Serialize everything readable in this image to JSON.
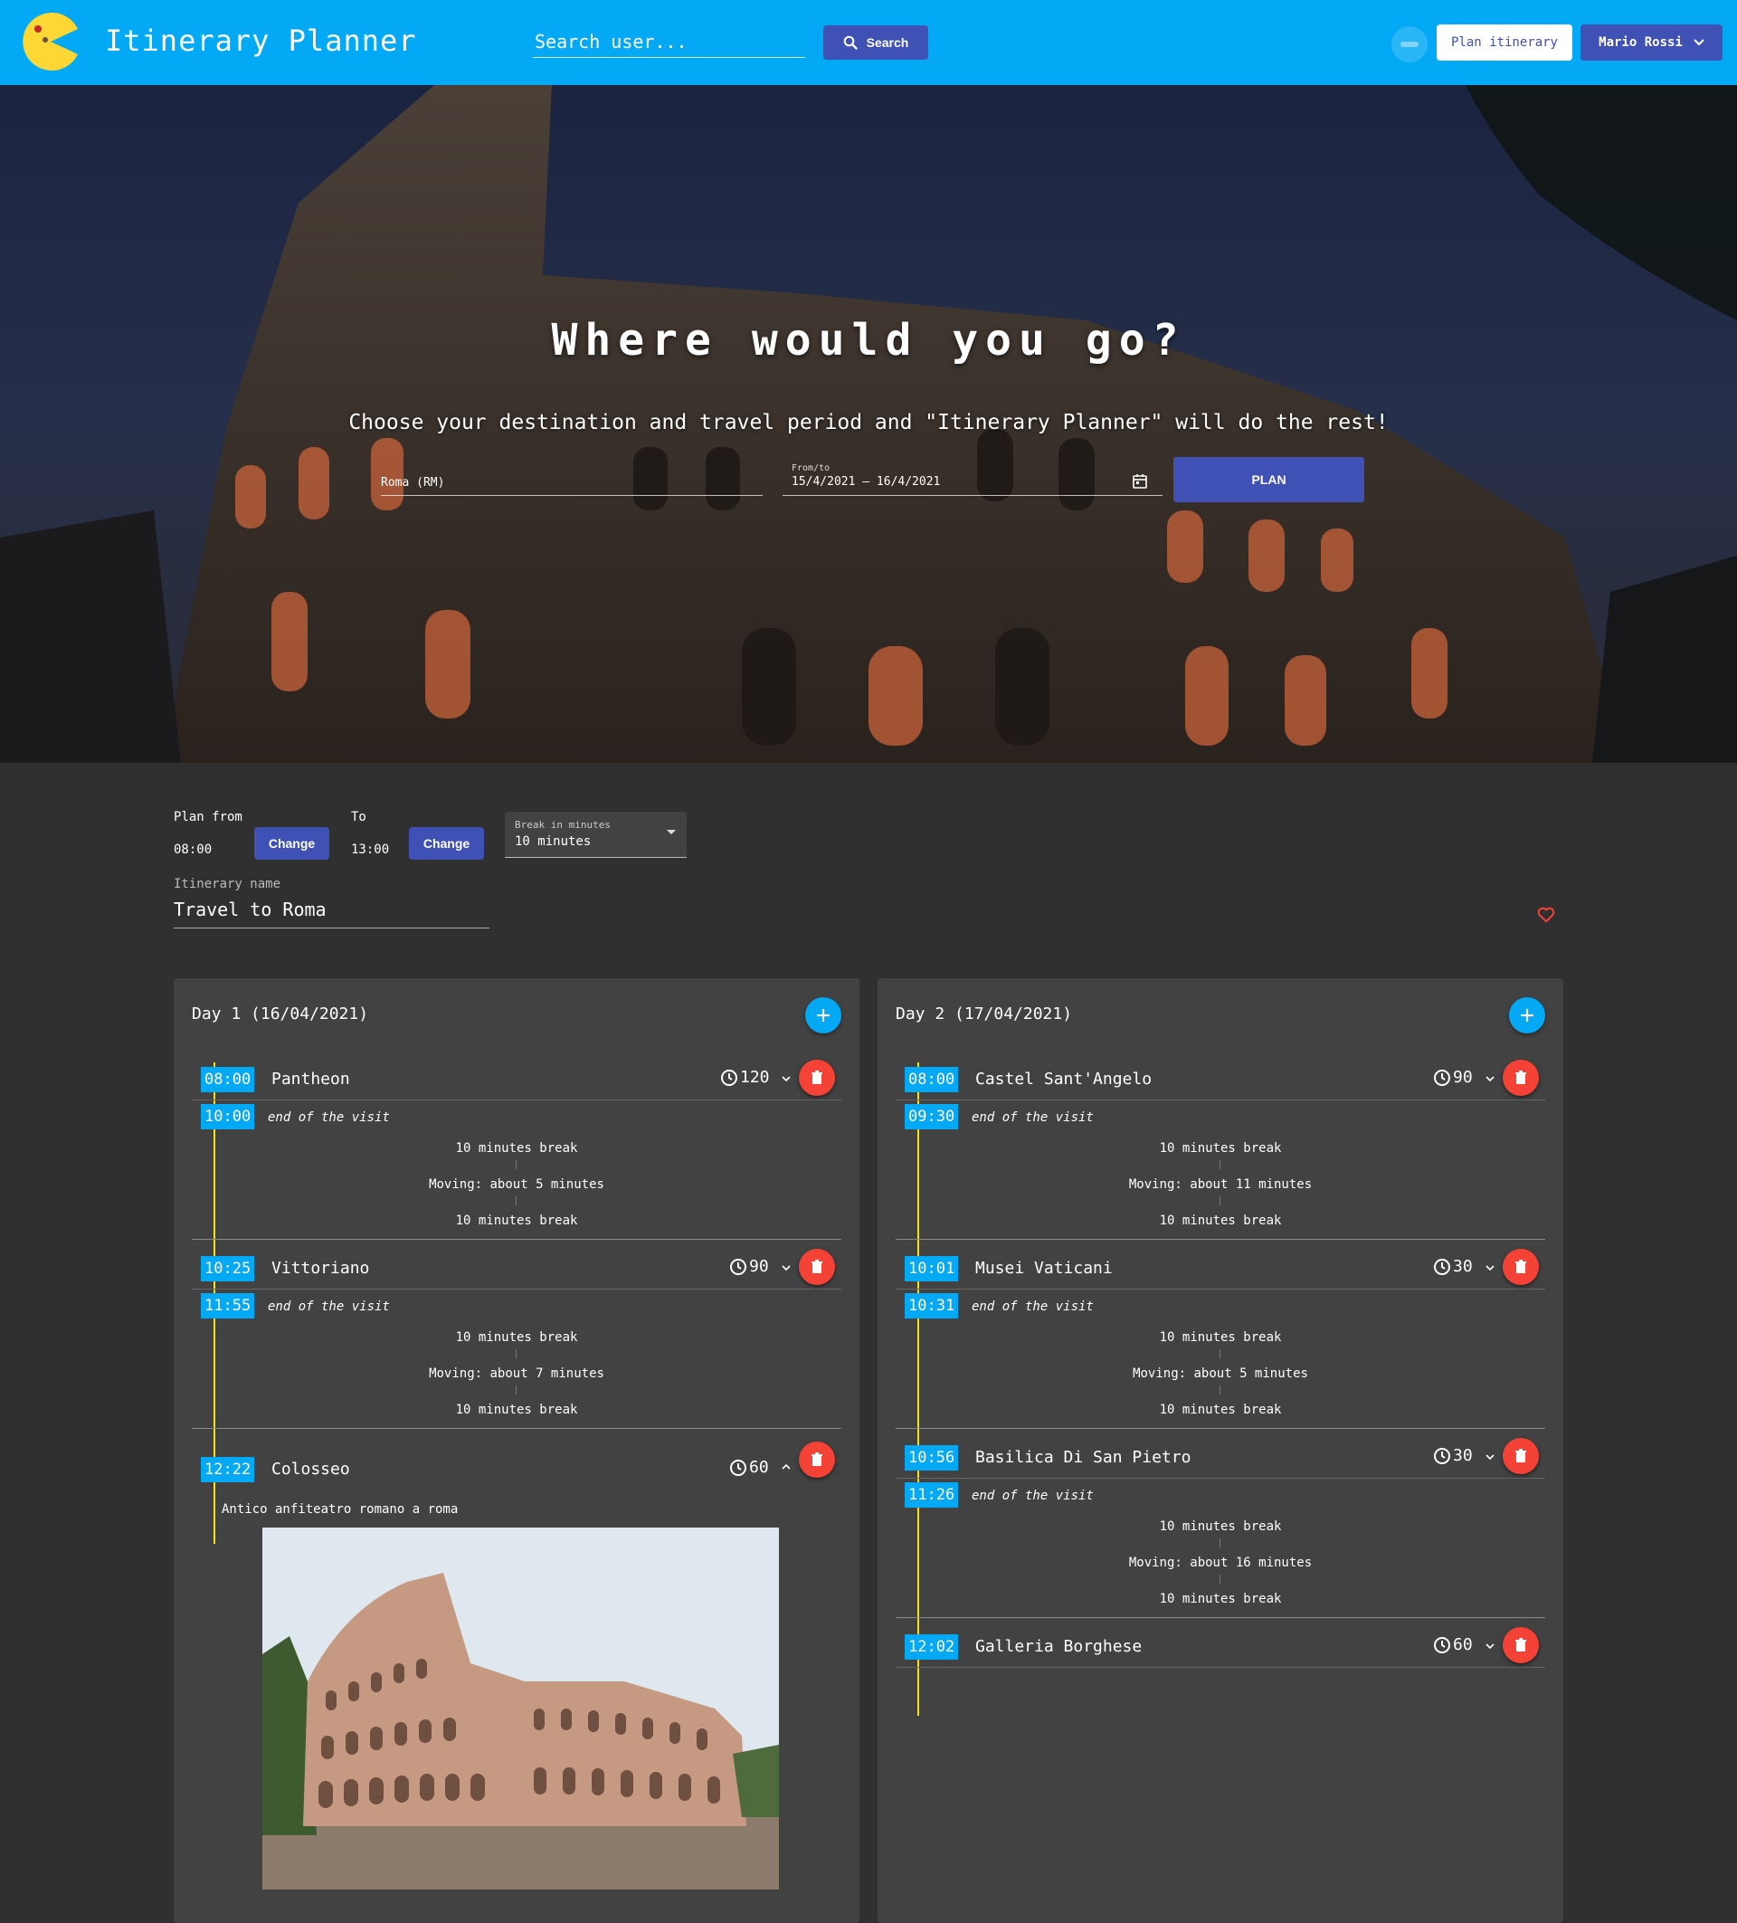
{
  "header": {
    "app_title": "Itinerary Planner",
    "search_placeholder": "Search user...",
    "search_button": "Search",
    "plan_itinerary_button": "Plan itinerary",
    "user_name": "Mario Rossi",
    "brand_color": "#03a9f4",
    "accent_color": "#3f51b5"
  },
  "hero": {
    "title": "Where would you go?",
    "subtitle": "Choose your destination and travel period and \"Itinerary Planner\" will do the rest!",
    "destination_value": "Roma (RM)",
    "date_label": "From/to",
    "date_value": "15/4/2021 – 16/4/2021",
    "plan_button": "PLAN"
  },
  "controls": {
    "plan_from_label": "Plan from",
    "plan_from_value": "08:00",
    "to_label": "To",
    "to_value": "13:00",
    "change_label": "Change",
    "break_label": "Break in minutes",
    "break_value": "10 minutes",
    "itinerary_name_label": "Itinerary name",
    "itinerary_name_value": "Travel to Roma"
  },
  "days": [
    {
      "title": "Day 1 (16/04/2021)",
      "attractions": [
        {
          "start": "08:00",
          "name": "Pantheon",
          "duration": "120",
          "end": "10:00",
          "end_text": "end of the visit",
          "gap": [
            "10 minutes break",
            "Moving: about 5 minutes",
            "10 minutes break"
          ]
        },
        {
          "start": "10:25",
          "name": "Vittoriano",
          "duration": "90",
          "end": "11:55",
          "end_text": "end of the visit",
          "gap": [
            "10 minutes break",
            "Moving: about 7 minutes",
            "10 minutes break"
          ]
        },
        {
          "start": "12:22",
          "name": "Colosseo",
          "duration": "60",
          "description": "Antico anfiteatro romano a roma"
        }
      ]
    },
    {
      "title": "Day 2 (17/04/2021)",
      "attractions": [
        {
          "start": "08:00",
          "name": "Castel Sant'Angelo",
          "duration": "90",
          "end": "09:30",
          "end_text": "end of the visit",
          "gap": [
            "10 minutes break",
            "Moving: about 11 minutes",
            "10 minutes break"
          ]
        },
        {
          "start": "10:01",
          "name": "Musei Vaticani",
          "duration": "30",
          "end": "10:31",
          "end_text": "end of the visit",
          "gap": [
            "10 minutes break",
            "Moving: about 5 minutes",
            "10 minutes break"
          ]
        },
        {
          "start": "10:56",
          "name": "Basilica Di San Pietro",
          "duration": "30",
          "end": "11:26",
          "end_text": "end of the visit",
          "gap": [
            "10 minutes break",
            "Moving: about 16 minutes",
            "10 minutes break"
          ]
        },
        {
          "start": "12:02",
          "name": "Galleria Borghese",
          "duration": "60"
        }
      ]
    }
  ],
  "icons": {
    "logo": "pacman-logo",
    "search": "search-icon",
    "calendar": "calendar-icon",
    "favorite": "heart-outline-icon",
    "add": "plus-icon",
    "delete": "trash-icon",
    "clock": "clock-icon"
  }
}
